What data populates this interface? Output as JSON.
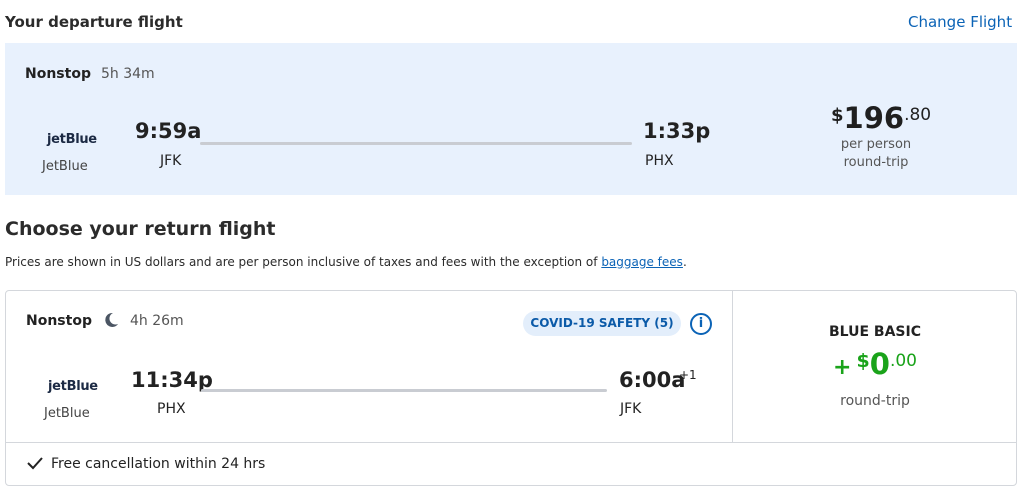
{
  "departure": {
    "title": "Your departure flight",
    "change_label": "Change Flight",
    "stops": "Nonstop",
    "duration": "5h 34m",
    "airline_logo": "jetBlue",
    "airline": "JetBlue",
    "depart_time": "9:59a",
    "depart_code": "JFK",
    "arrive_time": "1:33p",
    "arrive_code": "PHX",
    "price_symbol": "$",
    "price_whole": "196",
    "price_cents": ".80",
    "price_note1": "per person",
    "price_note2": "round-trip"
  },
  "return": {
    "title": "Choose your return flight",
    "note_text": "Prices are shown in US dollars and are per person inclusive of taxes and fees with the exception of ",
    "note_link": "baggage fees",
    "note_end": ".",
    "stops": "Nonstop",
    "duration": "4h 26m",
    "covid_label": "COVID-19 SAFETY (5)",
    "airline_logo": "jetBlue",
    "airline": "JetBlue",
    "depart_time": "11:34p",
    "depart_code": "PHX",
    "arrive_time": "6:00a",
    "arrive_offset": "+1",
    "arrive_code": "JFK",
    "fare_name": "BLUE BASIC",
    "fare_plus": "+",
    "fare_symbol": "$",
    "fare_whole": "0",
    "fare_cents": ".00",
    "fare_note": "round-trip",
    "cancellation": "Free cancellation within 24 hrs"
  },
  "colors": {
    "accent": "#0b63b6",
    "card_bg": "#e8f1fd",
    "green": "#1aa31a"
  },
  "icons": {
    "moon": "moon-icon",
    "info": "info-icon",
    "check": "checkmark-icon"
  }
}
